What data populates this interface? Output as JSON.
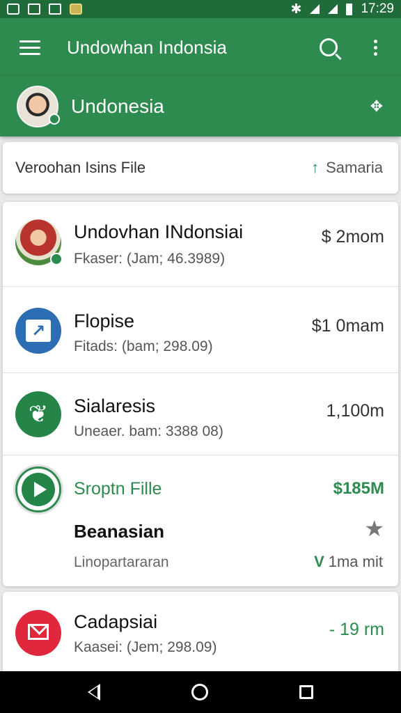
{
  "statusbar": {
    "time": "17:29"
  },
  "appbar": {
    "title": "Undowhan Indonsia"
  },
  "profile": {
    "name": "Undonesia"
  },
  "header": {
    "label": "Veroohan Isins File",
    "filter_label": "Samaria",
    "filter_icon": "↑"
  },
  "items": [
    {
      "title": "Undovhan INdonsiai",
      "subtitle": "Fkaser: (Jam; 46.3989)",
      "value": "$ 2mom"
    },
    {
      "title": "Flopise",
      "subtitle": "Fitads: (bam; 298.09)",
      "value": "$1 0mam"
    },
    {
      "title": "Sialaresis",
      "subtitle": "Uneaer. bam: 3388 08)",
      "value": "1,100m"
    },
    {
      "title": "Sroptn Fille",
      "value": "$185M",
      "bold_label": "Beanasian",
      "subtitle": "Linopartararan",
      "meta": "1ma mit",
      "meta_icon": "V"
    },
    {
      "title": "Cadapsiai",
      "subtitle": "Kaasei: (Jem; 298.09)",
      "value": "- 19 rm"
    }
  ],
  "colors": {
    "primary": "#2e8b4f",
    "statusbar": "#1f6b3a",
    "alert_red": "#e0273b",
    "blue": "#2c6db3"
  }
}
